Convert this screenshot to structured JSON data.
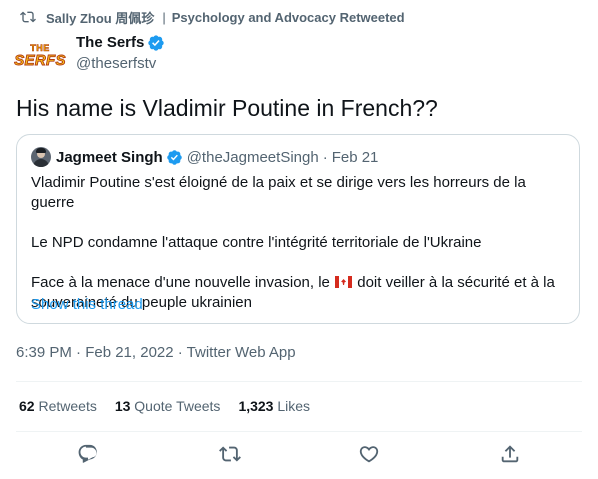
{
  "retweet_bar": {
    "icon": "retweet-icon",
    "retweeter": "Sally Zhou 周佩珍",
    "separator": "|",
    "context": "Psychology and Advocacy Retweeted"
  },
  "author": {
    "logo_top": "THE",
    "logo_main": "SERFS",
    "name": "The Serfs",
    "handle": "@theserfstv",
    "verified_icon": "verified-badge-icon"
  },
  "tweet": {
    "text": "His name is Vladimir Poutine in French??"
  },
  "quoted": {
    "name": "Jagmeet Singh",
    "handle": "@theJagmeetSingh",
    "dot": "·",
    "date": "Feb 21",
    "line1": "Vladimir Poutine s'est éloigné de la paix et se dirige vers les horreurs de la guerre",
    "line2": "Le NPD condamne l'attaque contre l'intégrité territoriale de l'Ukraine",
    "line3_before_flag": "Face à la menace d'une nouvelle invasion, le",
    "flag": "canada-flag-icon",
    "line3_after_flag": "doit veiller à la sécurité et à la souveraineté du peuple ukrainien",
    "show_thread": "Show this thread"
  },
  "timestamp": "6:39 PM · Feb 21, 2022 · Twitter Web App",
  "stats": {
    "retweets_count": "62",
    "retweets_label": "Retweets",
    "quotes_count": "13",
    "quotes_label": "Quote Tweets",
    "likes_count": "1,323",
    "likes_label": "Likes"
  },
  "actions": [
    "reply-icon",
    "retweet-icon",
    "like-icon",
    "share-icon"
  ],
  "colors": {
    "accent": "#1d9bf0",
    "secondary_text": "#536471",
    "border": "#cfd9de",
    "divider": "#eff3f4"
  }
}
